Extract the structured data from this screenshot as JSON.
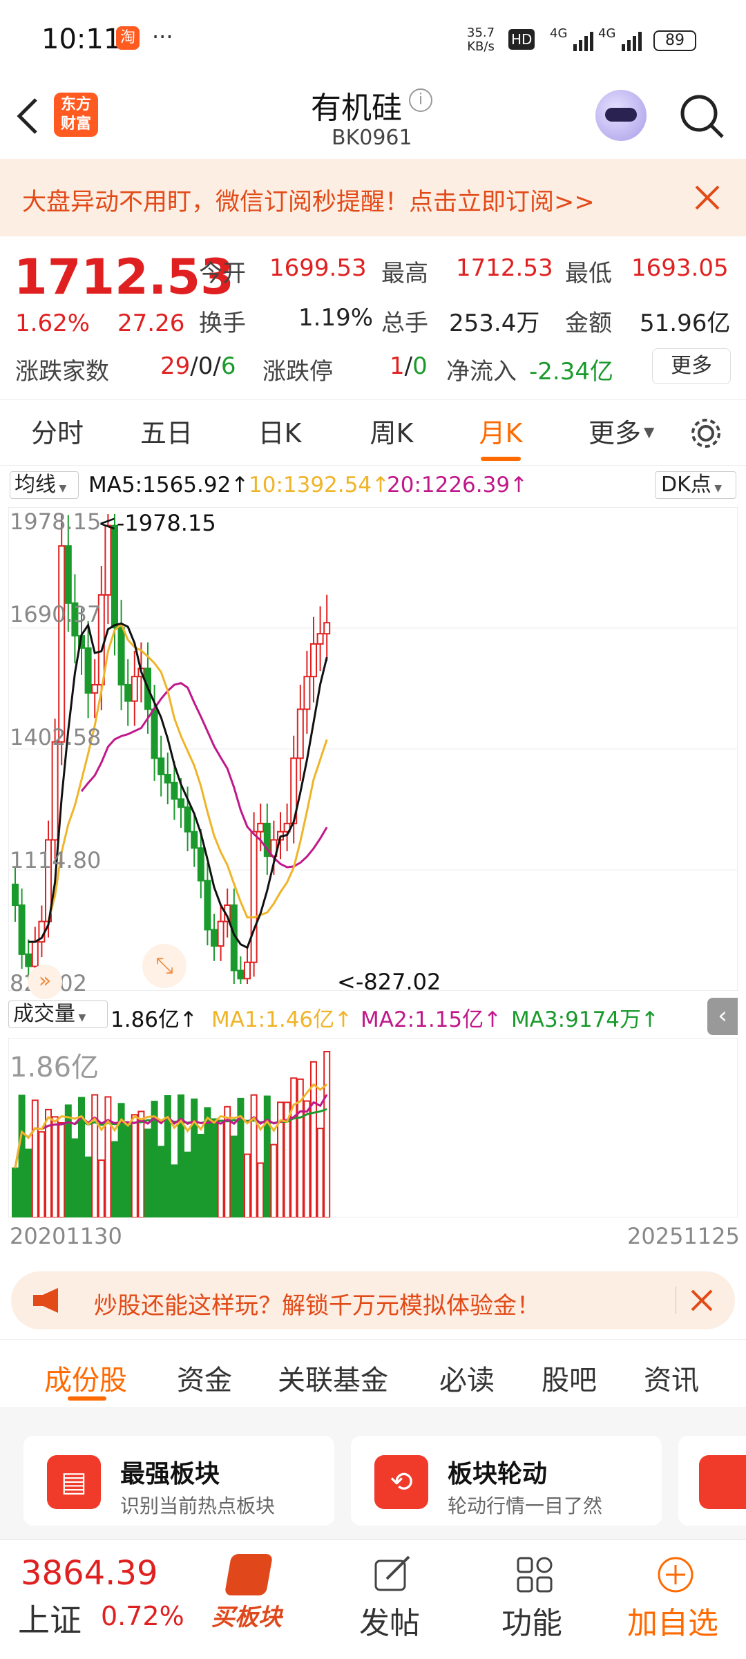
{
  "status_bar": {
    "time": "10:11",
    "more": "···",
    "speed_top": "35.7",
    "speed_bottom": "KB/s",
    "hd": "HD",
    "net1": "4G",
    "net2": "4G",
    "battery": "89"
  },
  "nav": {
    "title": "有机硅",
    "code": "BK0961",
    "logo_line1": "东方",
    "logo_line2": "财富"
  },
  "banner": {
    "text": "大盘异动不用盯，微信订阅秒提醒！点击立即订阅>>"
  },
  "quote": {
    "price": "1712.53",
    "change_pct": "1.62%",
    "change": "27.26",
    "open_label": "今开",
    "open": "1699.53",
    "high_label": "最高",
    "high": "1712.53",
    "low_label": "最低",
    "low": "1693.05",
    "turnover_label": "换手",
    "turnover": "1.19%",
    "volume_label": "总手",
    "volume": "253.4万",
    "amount_label": "金额",
    "amount": "51.96亿",
    "updown_label": "涨跌家数",
    "up": "29",
    "flat": "0",
    "down": "6",
    "limit_label": "涨跌停",
    "limit_up": "1",
    "limit_down": "0",
    "inflow_label": "净流入",
    "inflow": "-2.34亿",
    "more_btn": "更多"
  },
  "period_tabs": [
    "分时",
    "五日",
    "日K",
    "周K",
    "月K",
    "更多"
  ],
  "active_tab": "月K",
  "ma": {
    "selector": "均线",
    "ma5": "MA5:1565.92↑",
    "ma10": "10:1392.54↑",
    "ma20": "20:1226.39↑",
    "dk": "DK点"
  },
  "price_axis": {
    "ticks": [
      "1978.15",
      "1690.37",
      "1402.58",
      "1114.80",
      "827.02"
    ],
    "max_label": "<-1978.15",
    "min_label": "<-827.02"
  },
  "vol": {
    "selector": "成交量",
    "value": "1.86亿↑",
    "ma1": "MA1:1.46亿↑",
    "ma2": "MA2:1.15亿↑",
    "ma3": "MA3:9174万↑",
    "axis_label": "1.86亿"
  },
  "dates": {
    "start": "20201130",
    "end": "20251125"
  },
  "ad": {
    "text": "炒股还能这样玩？解锁千万元模拟体验金！"
  },
  "sub_tabs": [
    "成份股",
    "资金",
    "关联基金",
    "必读",
    "股吧",
    "资讯"
  ],
  "cards": [
    {
      "title": "最强板块",
      "desc": "识别当前热点板块"
    },
    {
      "title": "板块轮动",
      "desc": "轮动行情一目了然"
    }
  ],
  "bottom": {
    "index_value": "3864.39",
    "index_name": "上证",
    "index_change": "0.72%",
    "buy": "买板块",
    "post": "发帖",
    "func": "功能",
    "add": "加自选"
  },
  "colors": {
    "up": "#e02020",
    "down": "#1a9a2c",
    "accent": "#ff6a00",
    "ma5": "#111111",
    "ma10": "#f0b429",
    "ma20": "#c0188a"
  },
  "chart_data": {
    "type": "candlestick",
    "title": "",
    "ylim": [
      827.02,
      1978.15
    ],
    "x_range": [
      "20201130",
      "20251125"
    ],
    "close_approx": [
      1020,
      900,
      870,
      930,
      980,
      1180,
      1420,
      1900,
      1760,
      1680,
      1650,
      1540,
      1560,
      1780,
      1950,
      1700,
      1560,
      1520,
      1580,
      1600,
      1500,
      1380,
      1340,
      1320,
      1280,
      1260,
      1200,
      1160,
      1080,
      960,
      920,
      980,
      1020,
      860,
      840,
      880,
      1200,
      1220,
      1140,
      1180,
      1200,
      1220,
      1380,
      1500,
      1580,
      1660,
      1685,
      1712
    ],
    "volume_max_label": "1.86亿"
  }
}
